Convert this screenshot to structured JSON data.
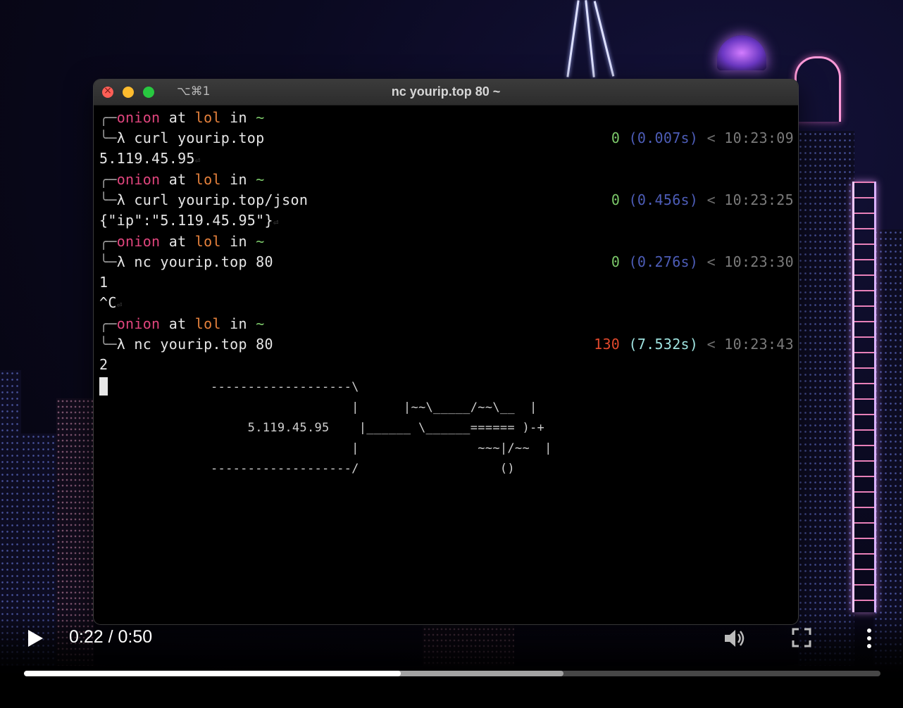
{
  "window": {
    "title": "nc yourip.top 80 ~",
    "shortcut": "⌥⌘1"
  },
  "prompt": {
    "user": "onion",
    "at": "at",
    "host": "lol",
    "in": "in",
    "dir": "~"
  },
  "commands": [
    {
      "cmd": "curl yourip.top",
      "status": "0",
      "duration": "(0.007s)",
      "time": "10:23:09",
      "output": [
        "5.119.45.95"
      ]
    },
    {
      "cmd": "curl yourip.top/json",
      "status": "0",
      "duration": "(0.456s)",
      "time": "10:23:25",
      "output": [
        "{\"ip\":\"5.119.45.95\"}"
      ]
    },
    {
      "cmd": "nc yourip.top 80",
      "status": "0",
      "duration": "(0.276s)",
      "time": "10:23:30",
      "output": [
        "1",
        "^C"
      ]
    },
    {
      "cmd": "nc yourip.top 80",
      "status": "130",
      "duration": "(7.532s)",
      "time": "10:23:43",
      "output": [
        "2"
      ]
    }
  ],
  "ascii_art": "-------------------\\\n                   |      |~~\\_____/~~\\__  |\n     5.119.45.95    |______ \\______====== )-+\n                   |                ~~~|/~~  |\n-------------------/                   ()",
  "player": {
    "current_time": "0:22",
    "duration": "0:50",
    "time_display": "0:22 / 0:50",
    "played_fraction": 0.44,
    "buffered_fraction": 0.63
  },
  "colors": {
    "prompt_user": "#e0457d",
    "prompt_host": "#e6813c",
    "status_ok": "#7cc96a",
    "status_error": "#e0482c",
    "duration": "#4d5db8",
    "duration_highlight": "#9fe3e0"
  },
  "icons": [
    "play-icon",
    "volume-icon",
    "fullscreen-icon",
    "more-options-icon"
  ]
}
